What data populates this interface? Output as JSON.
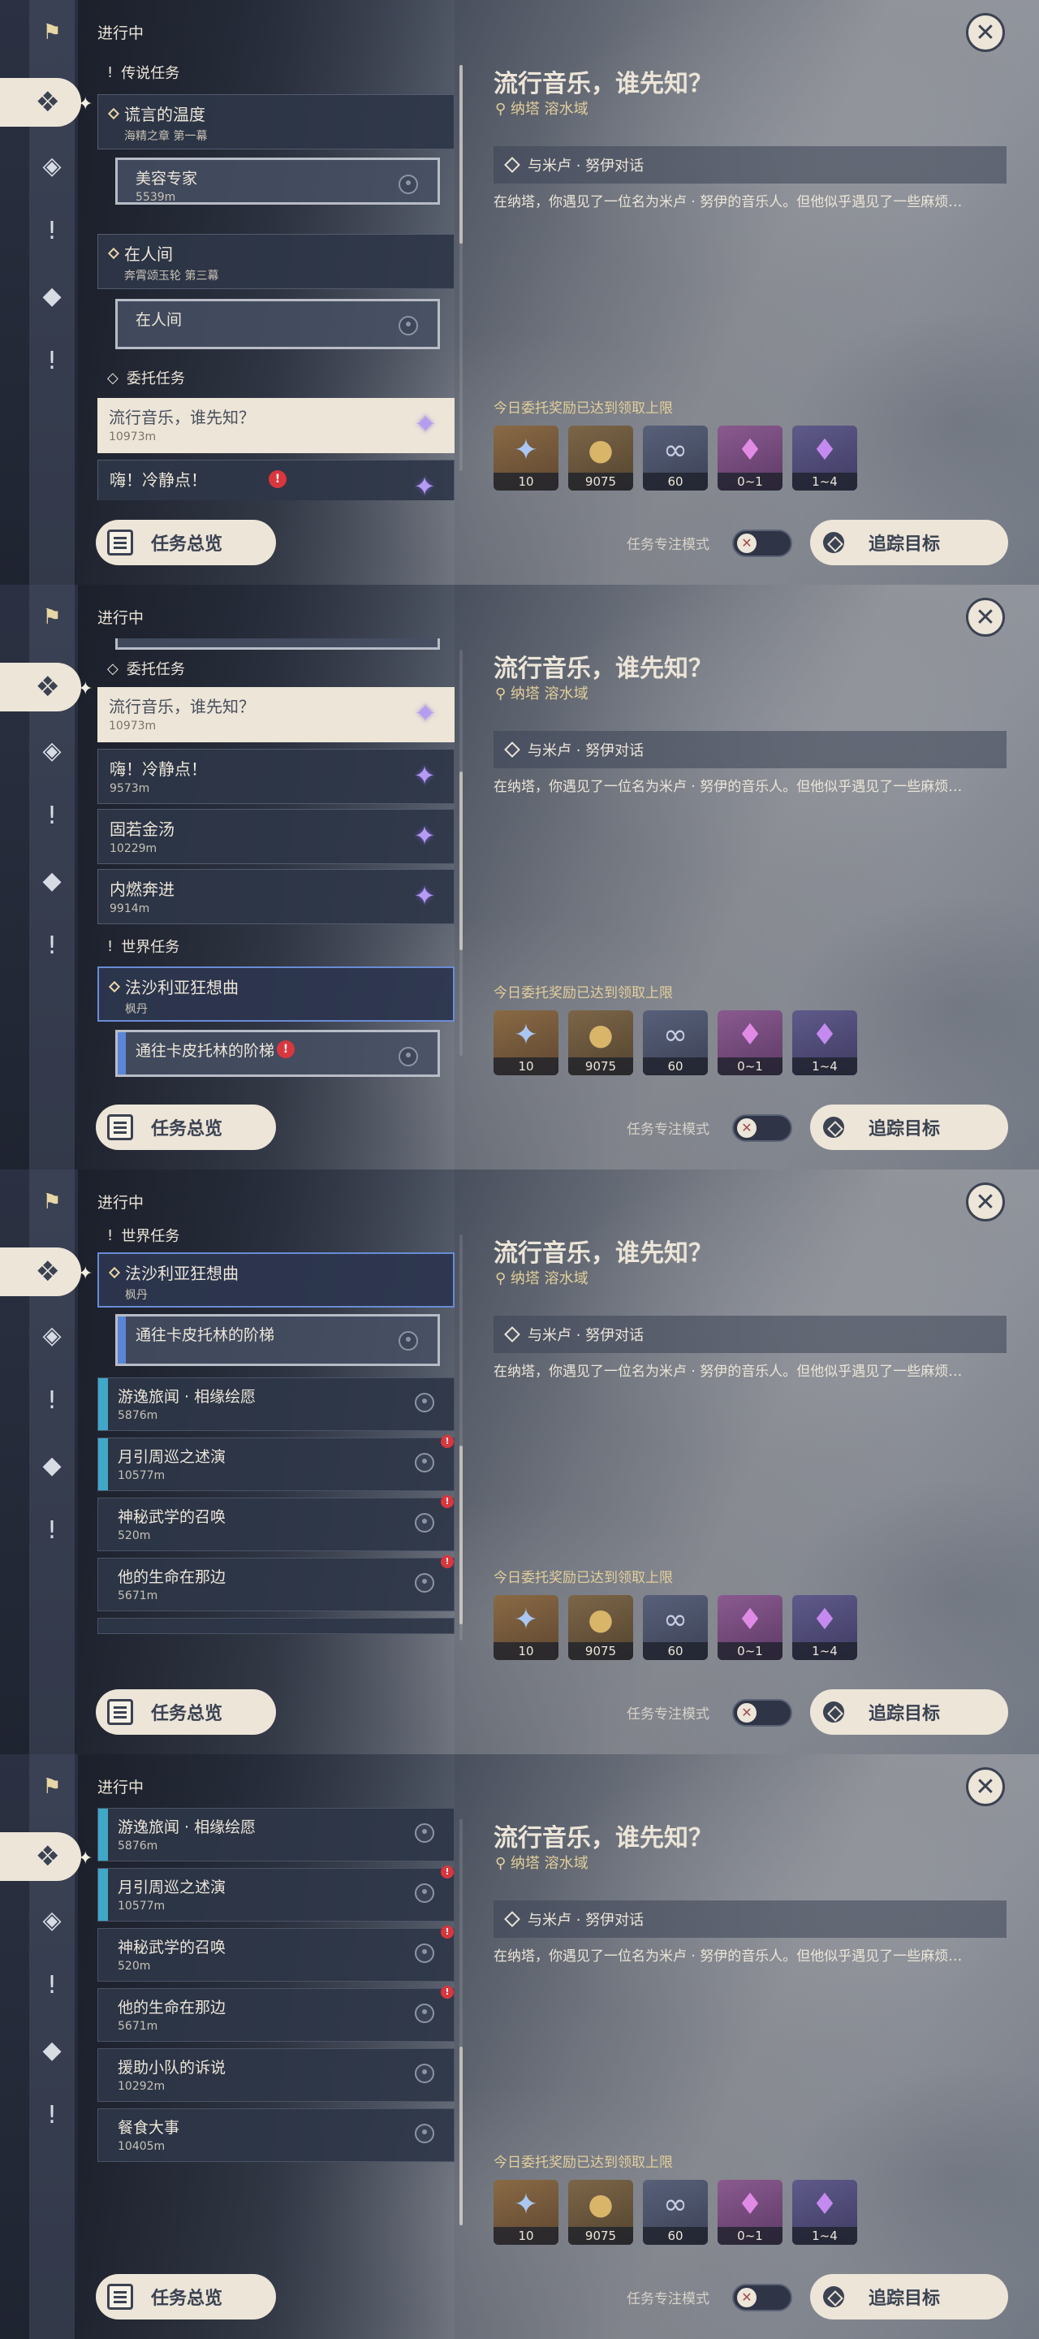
{
  "header": {
    "status": "进行中"
  },
  "detail": {
    "title": "流行音乐，谁先知？",
    "location": "纳塔 溶水域",
    "objective": "与米卢 · 努伊对话",
    "description": "在纳塔，你遇见了一位名为米卢 · 努伊的音乐人。但他似乎遇见了一些麻烦…",
    "limit_note": "今日委托奖励已达到领取上限",
    "rewards": [
      {
        "name": "primogem",
        "icon": "✦",
        "count": "10"
      },
      {
        "name": "mora",
        "icon": "●",
        "count": "9075"
      },
      {
        "name": "friendship",
        "icon": "∞",
        "count": "60"
      },
      {
        "name": "crystal",
        "icon": "♦",
        "count": "0~1"
      },
      {
        "name": "crystal-purple",
        "icon": "♦",
        "count": "1~4"
      }
    ]
  },
  "bottom": {
    "overview": "任务总览",
    "focus": "任务专注模式",
    "track": "追踪目标"
  },
  "panels": [
    {
      "items": [
        {
          "type": "cat",
          "text": "传说任务",
          "icon": "!"
        },
        {
          "type": "quest",
          "title": "谎言的温度",
          "sub": "海精之章 第一幕"
        },
        {
          "type": "sub",
          "title": "美容专家",
          "dist": "5539m"
        },
        {
          "type": "quest",
          "title": "在人间",
          "sub": "奔霄颂玉轮 第三幕"
        },
        {
          "type": "sub",
          "title": "在人间",
          "dist": ""
        },
        {
          "type": "cat",
          "text": "委托任务",
          "icon": "◇"
        },
        {
          "type": "light",
          "title": "流行音乐，谁先知？",
          "sub": "10973m"
        },
        {
          "type": "commission",
          "title": "嗨！冷静点！",
          "sub": ""
        }
      ]
    },
    {
      "items": [
        {
          "type": "cat",
          "text": "委托任务",
          "icon": "◇"
        },
        {
          "type": "light",
          "title": "流行音乐，谁先知？",
          "sub": "10973m"
        },
        {
          "type": "commission",
          "title": "嗨！冷静点！",
          "sub": "9573m"
        },
        {
          "type": "commission",
          "title": "固若金汤",
          "sub": "10229m"
        },
        {
          "type": "commission",
          "title": "内燃奔进",
          "sub": "9914m"
        },
        {
          "type": "cat",
          "text": "世界任务",
          "icon": "!"
        },
        {
          "type": "quest",
          "title": "法沙利亚狂想曲",
          "sub": "枫丹"
        },
        {
          "type": "sub",
          "title": "通往卡皮托林的阶梯",
          "dist": ""
        }
      ]
    },
    {
      "items": [
        {
          "type": "cat",
          "text": "世界任务",
          "icon": "!"
        },
        {
          "type": "quest",
          "title": "法沙利亚狂想曲",
          "sub": "枫丹"
        },
        {
          "type": "sub",
          "title": "通往卡皮托林的阶梯",
          "dist": ""
        },
        {
          "type": "lq",
          "title": "游逸旅闻 · 相缘绘愿",
          "sub": "5876m"
        },
        {
          "type": "lq",
          "title": "月引周巡之述演",
          "sub": "10577m"
        },
        {
          "type": "lq",
          "title": "神秘武学的召唤",
          "sub": "520m"
        },
        {
          "type": "lq",
          "title": "他的生命在那边",
          "sub": "5671m"
        }
      ]
    },
    {
      "items": [
        {
          "type": "lq",
          "title": "游逸旅闻 · 相缘绘愿",
          "sub": "5876m"
        },
        {
          "type": "lq",
          "title": "月引周巡之述演",
          "sub": "10577m"
        },
        {
          "type": "lq",
          "title": "神秘武学的召唤",
          "sub": "520m"
        },
        {
          "type": "lq",
          "title": "他的生命在那边",
          "sub": "5671m"
        },
        {
          "type": "lq",
          "title": "援助小队的诉说",
          "sub": "10292m"
        },
        {
          "type": "lq",
          "title": "餐食大事",
          "sub": "10405m"
        }
      ]
    }
  ]
}
